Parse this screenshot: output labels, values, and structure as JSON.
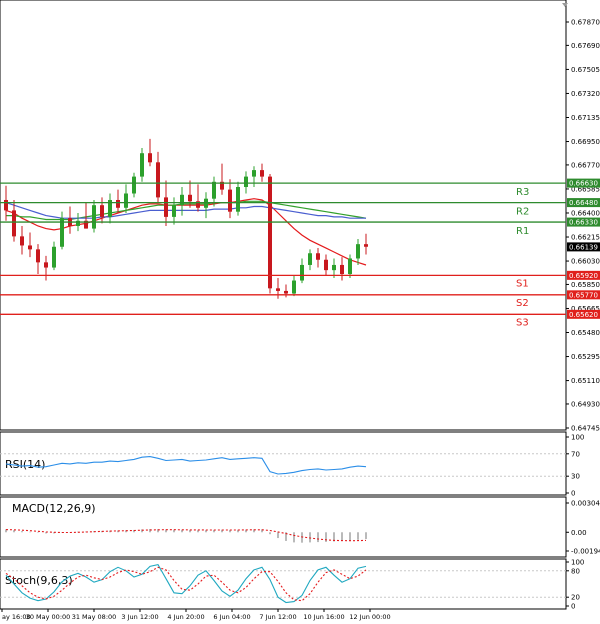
{
  "colors": {
    "bull": "#2ca02c",
    "bear": "#c8181e",
    "resistance": "#2e8b2e",
    "support": "#e0201c",
    "ma_red": "#e41a1c",
    "ma_green": "#33a02c",
    "ma_blue": "#4a5ed0",
    "rsi": "#2b8ee8",
    "macd_hist": "#a8a8a8",
    "macd_signal": "#e41a1c",
    "stoch_main": "#1fa8c0",
    "stoch_signal": "#e41a1c",
    "current_tag": "#000000"
  },
  "chart_data": [
    {
      "type": "candlestick",
      "panel": "price",
      "y_ticks": [
        "0.67870",
        "0.67690",
        "0.67505",
        "0.67320",
        "0.67135",
        "0.66950",
        "0.66770",
        "0.66585",
        "0.66400",
        "0.66215",
        "0.66030",
        "0.65850",
        "0.65665",
        "0.65480",
        "0.65295",
        "0.65110",
        "0.64930",
        "0.64745"
      ],
      "ylim": [
        0.64745,
        0.6787
      ],
      "x_ticks": [
        "ay 16:00",
        "30 May 00:00",
        "31 May 08:00",
        "3 Jun 12:00",
        "4 Jun 20:00",
        "6 Jun 04:00",
        "7 Jun 12:00",
        "10 Jun 16:00",
        "12 Jun 00:00"
      ],
      "candles": [
        {
          "o": 0.665,
          "h": 0.6661,
          "l": 0.6634,
          "c": 0.6642
        },
        {
          "o": 0.6642,
          "h": 0.665,
          "l": 0.6618,
          "c": 0.6622
        },
        {
          "o": 0.6622,
          "h": 0.663,
          "l": 0.6608,
          "c": 0.6615
        },
        {
          "o": 0.6615,
          "h": 0.6625,
          "l": 0.6606,
          "c": 0.6612
        },
        {
          "o": 0.6612,
          "h": 0.6616,
          "l": 0.6593,
          "c": 0.6602
        },
        {
          "o": 0.6602,
          "h": 0.6607,
          "l": 0.6588,
          "c": 0.6598
        },
        {
          "o": 0.6598,
          "h": 0.6618,
          "l": 0.6596,
          "c": 0.6614
        },
        {
          "o": 0.6614,
          "h": 0.6641,
          "l": 0.6612,
          "c": 0.6636
        },
        {
          "o": 0.6636,
          "h": 0.6645,
          "l": 0.6624,
          "c": 0.663
        },
        {
          "o": 0.663,
          "h": 0.664,
          "l": 0.6626,
          "c": 0.6634
        },
        {
          "o": 0.6634,
          "h": 0.6648,
          "l": 0.6628,
          "c": 0.6628
        },
        {
          "o": 0.6628,
          "h": 0.665,
          "l": 0.6625,
          "c": 0.6646
        },
        {
          "o": 0.6646,
          "h": 0.6652,
          "l": 0.6632,
          "c": 0.6637
        },
        {
          "o": 0.6637,
          "h": 0.6655,
          "l": 0.6632,
          "c": 0.665
        },
        {
          "o": 0.665,
          "h": 0.6658,
          "l": 0.664,
          "c": 0.6644
        },
        {
          "o": 0.6644,
          "h": 0.6662,
          "l": 0.664,
          "c": 0.6655
        },
        {
          "o": 0.6655,
          "h": 0.6671,
          "l": 0.6652,
          "c": 0.6668
        },
        {
          "o": 0.6668,
          "h": 0.669,
          "l": 0.6664,
          "c": 0.6686
        },
        {
          "o": 0.6686,
          "h": 0.6697,
          "l": 0.6676,
          "c": 0.6679
        },
        {
          "o": 0.6679,
          "h": 0.6687,
          "l": 0.6648,
          "c": 0.6652
        },
        {
          "o": 0.6652,
          "h": 0.6665,
          "l": 0.663,
          "c": 0.6637
        },
        {
          "o": 0.6637,
          "h": 0.6652,
          "l": 0.6631,
          "c": 0.6646
        },
        {
          "o": 0.6646,
          "h": 0.666,
          "l": 0.6638,
          "c": 0.6654
        },
        {
          "o": 0.6654,
          "h": 0.6665,
          "l": 0.6644,
          "c": 0.6649
        },
        {
          "o": 0.6649,
          "h": 0.6662,
          "l": 0.6641,
          "c": 0.6644
        },
        {
          "o": 0.6644,
          "h": 0.6656,
          "l": 0.6636,
          "c": 0.6651
        },
        {
          "o": 0.6651,
          "h": 0.6668,
          "l": 0.6645,
          "c": 0.6664
        },
        {
          "o": 0.6664,
          "h": 0.6678,
          "l": 0.6654,
          "c": 0.6658
        },
        {
          "o": 0.6658,
          "h": 0.6666,
          "l": 0.6636,
          "c": 0.6641
        },
        {
          "o": 0.6641,
          "h": 0.6664,
          "l": 0.6638,
          "c": 0.666
        },
        {
          "o": 0.666,
          "h": 0.6672,
          "l": 0.6655,
          "c": 0.6668
        },
        {
          "o": 0.6668,
          "h": 0.6676,
          "l": 0.666,
          "c": 0.6673
        },
        {
          "o": 0.6673,
          "h": 0.6678,
          "l": 0.6664,
          "c": 0.6668
        },
        {
          "o": 0.6668,
          "h": 0.667,
          "l": 0.6578,
          "c": 0.6582
        },
        {
          "o": 0.6582,
          "h": 0.659,
          "l": 0.6574,
          "c": 0.658
        },
        {
          "o": 0.658,
          "h": 0.6585,
          "l": 0.6575,
          "c": 0.6578
        },
        {
          "o": 0.6578,
          "h": 0.6592,
          "l": 0.6576,
          "c": 0.6588
        },
        {
          "o": 0.6588,
          "h": 0.6605,
          "l": 0.6586,
          "c": 0.66
        },
        {
          "o": 0.66,
          "h": 0.6612,
          "l": 0.6596,
          "c": 0.6609
        },
        {
          "o": 0.6609,
          "h": 0.6613,
          "l": 0.6598,
          "c": 0.6604
        },
        {
          "o": 0.6604,
          "h": 0.6608,
          "l": 0.6592,
          "c": 0.6596
        },
        {
          "o": 0.6596,
          "h": 0.6605,
          "l": 0.659,
          "c": 0.66
        },
        {
          "o": 0.66,
          "h": 0.6606,
          "l": 0.6588,
          "c": 0.6593
        },
        {
          "o": 0.6593,
          "h": 0.6608,
          "l": 0.659,
          "c": 0.6605
        },
        {
          "o": 0.6605,
          "h": 0.662,
          "l": 0.66,
          "c": 0.6616
        },
        {
          "o": 0.6616,
          "h": 0.6624,
          "l": 0.6608,
          "c": 0.6614
        }
      ],
      "moving_averages": [
        {
          "color_key": "ma_red",
          "values": [
            0.6642,
            0.664,
            0.6636,
            0.6633,
            0.663,
            0.6628,
            0.6627,
            0.6628,
            0.663,
            0.6631,
            0.6632,
            0.6634,
            0.6636,
            0.6638,
            0.664,
            0.6642,
            0.6644,
            0.6646,
            0.6647,
            0.6647,
            0.6646,
            0.6646,
            0.6646,
            0.6646,
            0.6646,
            0.6646,
            0.6647,
            0.6648,
            0.6648,
            0.6649,
            0.665,
            0.6651,
            0.665,
            0.6646,
            0.664,
            0.6634,
            0.6628,
            0.6623,
            0.6619,
            0.6616,
            0.6613,
            0.661,
            0.6607,
            0.6604,
            0.6602,
            0.66
          ]
        },
        {
          "color_key": "ma_green",
          "values": [
            0.6638,
            0.6638,
            0.6637,
            0.6637,
            0.6636,
            0.6635,
            0.6635,
            0.6635,
            0.6635,
            0.6636,
            0.6637,
            0.6638,
            0.6639,
            0.664,
            0.6641,
            0.6642,
            0.6643,
            0.6644,
            0.6645,
            0.6646,
            0.6646,
            0.6646,
            0.6647,
            0.6647,
            0.6647,
            0.6647,
            0.6648,
            0.6648,
            0.6648,
            0.6648,
            0.6649,
            0.6649,
            0.6649,
            0.6648,
            0.6647,
            0.6646,
            0.6645,
            0.6644,
            0.6643,
            0.6642,
            0.6641,
            0.664,
            0.6639,
            0.6638,
            0.6637,
            0.6636
          ]
        },
        {
          "color_key": "ma_blue",
          "values": [
            0.6648,
            0.6646,
            0.6644,
            0.6642,
            0.664,
            0.6638,
            0.6637,
            0.6636,
            0.6636,
            0.6636,
            0.6636,
            0.6636,
            0.6637,
            0.6637,
            0.6638,
            0.6639,
            0.664,
            0.6641,
            0.6642,
            0.6642,
            0.6642,
            0.6642,
            0.6642,
            0.6642,
            0.6642,
            0.6642,
            0.6643,
            0.6643,
            0.6643,
            0.6644,
            0.6644,
            0.6645,
            0.6645,
            0.6644,
            0.6643,
            0.6642,
            0.6641,
            0.664,
            0.6639,
            0.6638,
            0.6638,
            0.6637,
            0.6637,
            0.6636,
            0.6636,
            0.6636
          ]
        }
      ],
      "levels": [
        {
          "label": "R3",
          "value": 0.6663,
          "tag": "0.66630",
          "kind": "resistance"
        },
        {
          "label": "R2",
          "value": 0.6648,
          "tag": "0.66480",
          "kind": "resistance"
        },
        {
          "label": "R1",
          "value": 0.6633,
          "tag": "0.66330",
          "kind": "resistance"
        },
        {
          "label": "S1",
          "value": 0.6592,
          "tag": "0.65920",
          "kind": "support"
        },
        {
          "label": "S2",
          "value": 0.6577,
          "tag": "0.65770",
          "kind": "support"
        },
        {
          "label": "S3",
          "value": 0.6562,
          "tag": "0.65620",
          "kind": "support"
        }
      ],
      "current_price": {
        "value": 0.66139,
        "tag": "0.66139"
      }
    },
    {
      "type": "line",
      "panel": "rsi",
      "title": "RSI(14)",
      "y_ticks": [
        "100",
        "70",
        "30",
        "0"
      ],
      "ylim": [
        0,
        100
      ],
      "series": [
        {
          "color_key": "rsi",
          "values": [
            52,
            50,
            48,
            49,
            46,
            47,
            50,
            53,
            52,
            54,
            53,
            55,
            55,
            57,
            56,
            58,
            60,
            64,
            65,
            62,
            58,
            59,
            60,
            57,
            58,
            59,
            61,
            63,
            60,
            61,
            62,
            63,
            62,
            38,
            34,
            35,
            37,
            40,
            42,
            43,
            41,
            42,
            43,
            46,
            48,
            47
          ]
        }
      ]
    },
    {
      "type": "bar",
      "panel": "macd",
      "title": "MACD(12,26,9)",
      "y_ticks": [
        "0.00304",
        "0.00",
        "-0.001945"
      ],
      "ylim": [
        -0.001945,
        0.00304
      ],
      "histogram": [
        0.0003,
        0.00022,
        0.00012,
        5e-05,
        -5e-05,
        -0.00012,
        -0.00012,
        -5e-05,
        2e-05,
        6e-05,
        8e-05,
        0.00012,
        0.00014,
        0.00017,
        0.00018,
        0.0002,
        0.00024,
        0.0003,
        0.00034,
        0.00032,
        0.00028,
        0.00026,
        0.00025,
        0.00024,
        0.00022,
        0.00022,
        0.00024,
        0.00026,
        0.00024,
        0.00025,
        0.00027,
        0.0003,
        0.0003,
        -0.0002,
        -0.0006,
        -0.0009,
        -0.00105,
        -0.00108,
        -0.00105,
        -0.00102,
        -0.001,
        -0.00096,
        -0.00092,
        -0.00086,
        -0.00078,
        -0.0007
      ],
      "signal": [
        0.00028,
        0.00026,
        0.00022,
        0.00016,
        0.0001,
        4e-05,
        0.0,
        -2e-05,
        -2e-05,
        0.0,
        3e-05,
        6e-05,
        9e-05,
        0.00012,
        0.00014,
        0.00016,
        0.00018,
        0.00021,
        0.00024,
        0.00026,
        0.00027,
        0.00027,
        0.00026,
        0.00025,
        0.00025,
        0.00024,
        0.00024,
        0.00024,
        0.00024,
        0.00024,
        0.00025,
        0.00026,
        0.00026,
        0.00018,
        4e-05,
        -0.00014,
        -0.00032,
        -0.00048,
        -0.0006,
        -0.0007,
        -0.00078,
        -0.00084,
        -0.00087,
        -0.00088,
        -0.00087,
        -0.00084
      ]
    },
    {
      "type": "line",
      "panel": "stochastic",
      "title": "Stoch(9,6,3)",
      "y_ticks": [
        "100",
        "80",
        "20",
        "0"
      ],
      "ylim": [
        0,
        100
      ],
      "series": [
        {
          "color_key": "stoch_main",
          "values": [
            70,
            50,
            30,
            18,
            12,
            16,
            32,
            55,
            68,
            74,
            66,
            54,
            60,
            78,
            88,
            80,
            66,
            72,
            90,
            94,
            62,
            30,
            28,
            46,
            70,
            80,
            58,
            34,
            22,
            36,
            62,
            82,
            88,
            60,
            20,
            8,
            10,
            24,
            58,
            82,
            88,
            70,
            54,
            62,
            86,
            90
          ]
        },
        {
          "color_key": "stoch_signal",
          "values": [
            74,
            62,
            46,
            30,
            20,
            16,
            22,
            36,
            52,
            66,
            70,
            64,
            60,
            66,
            76,
            82,
            78,
            72,
            78,
            88,
            82,
            58,
            38,
            36,
            50,
            68,
            70,
            54,
            36,
            30,
            42,
            62,
            78,
            78,
            56,
            30,
            14,
            12,
            28,
            54,
            76,
            82,
            72,
            62,
            68,
            82
          ]
        }
      ]
    }
  ]
}
